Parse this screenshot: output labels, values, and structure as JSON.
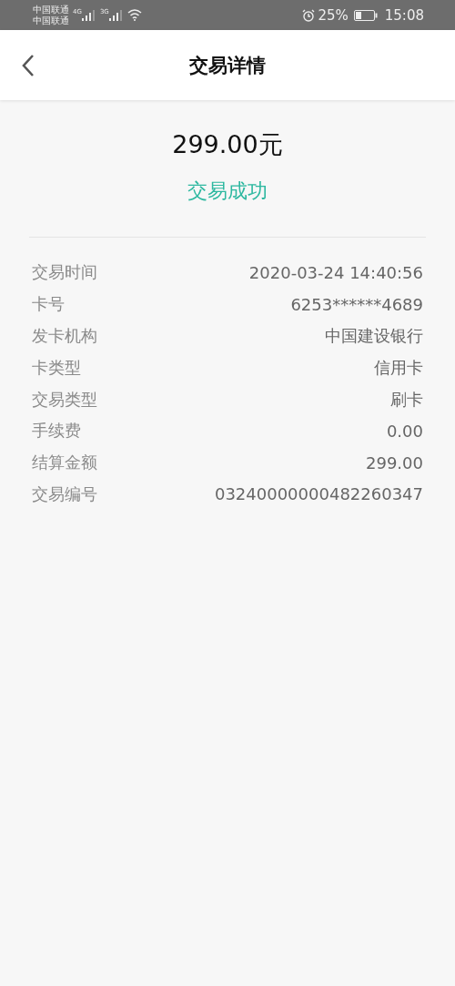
{
  "status_bar": {
    "carriers": [
      "中国联通",
      "中国联通"
    ],
    "networks": [
      "4G",
      "3G"
    ],
    "battery_percent": "25%",
    "time": "15:08"
  },
  "header": {
    "title": "交易详情"
  },
  "summary": {
    "amount": "299.00元",
    "status": "交易成功"
  },
  "details": [
    {
      "label": "交易时间",
      "value": "2020-03-24 14:40:56"
    },
    {
      "label": "卡号",
      "value": "6253******4689"
    },
    {
      "label": "发卡机构",
      "value": "中国建设银行"
    },
    {
      "label": "卡类型",
      "value": "信用卡"
    },
    {
      "label": "交易类型",
      "value": "刷卡"
    },
    {
      "label": "手续费",
      "value": "0.00"
    },
    {
      "label": "结算金额",
      "value": "299.00"
    },
    {
      "label": "交易编号",
      "value": "03240000000482260347"
    }
  ]
}
